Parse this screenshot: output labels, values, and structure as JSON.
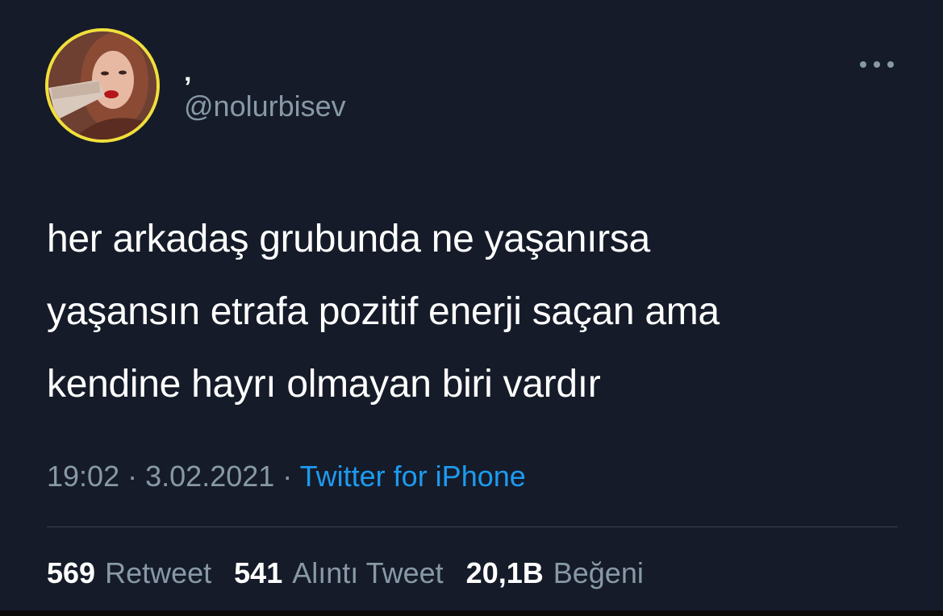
{
  "user": {
    "display_name": "‚",
    "handle": "@nolurbisev"
  },
  "more_icon": "more-horizontal-icon",
  "tweet": {
    "lines": [
      "her arkadaş grubunda ne yaşanırsa",
      "yaşansın etrafa pozitif enerji saçan ama",
      "kendine hayrı olmayan biri vardır"
    ],
    "time": "19:02",
    "date": "3.02.2021",
    "separator": "·",
    "source": "Twitter for iPhone"
  },
  "stats": [
    {
      "value": "569",
      "label": "Retweet"
    },
    {
      "value": "541",
      "label": "Alıntı Tweet"
    },
    {
      "value": "20,1B",
      "label": "Beğeni"
    }
  ],
  "colors": {
    "background": "#151b29",
    "text": "#ffffff",
    "secondary": "#8899a6",
    "link": "#1d9bf0",
    "avatar_ring": "#f1df3b"
  }
}
